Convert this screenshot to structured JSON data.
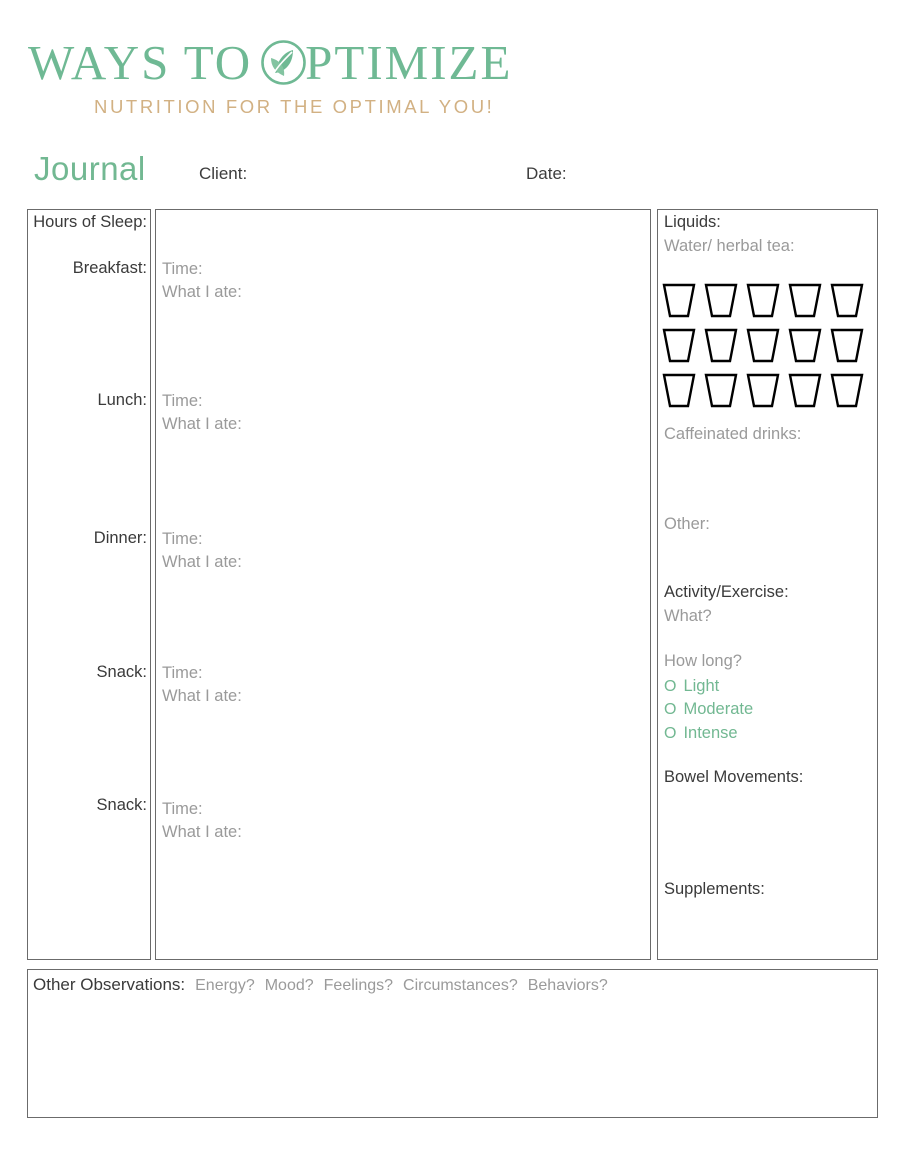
{
  "logo": {
    "word_1": "WAYS TO",
    "word_2": "PTIMIZE",
    "o_mark_icon": "leaf-in-circle-icon",
    "tagline": "NUTRITION FOR THE OPTIMAL YOU!",
    "green": "#6fb994",
    "gold": "#d2b183"
  },
  "title_row": {
    "journal": "Journal",
    "client_label": "Client:",
    "date_label": "Date:"
  },
  "left_column": {
    "sleep_label": "Hours of Sleep:",
    "meals": [
      {
        "label": "Breakfast:"
      },
      {
        "label": "Lunch:"
      },
      {
        "label": "Dinner:"
      },
      {
        "label": "Snack:"
      },
      {
        "label": "Snack:"
      }
    ]
  },
  "middle_column": {
    "entries": [
      {
        "time": "Time:",
        "what": "What I ate:"
      },
      {
        "time": "Time:",
        "what": "What I ate:"
      },
      {
        "time": "Time:",
        "what": "What I ate:"
      },
      {
        "time": "Time:",
        "what": "What I ate:"
      },
      {
        "time": "Time:",
        "what": "What I ate:"
      }
    ]
  },
  "right_column": {
    "liquids_heading": "Liquids:",
    "water_label": "Water/ herbal tea:",
    "cup_icon": "drinking-glass-icon",
    "cup_rows": 3,
    "cups_per_row": 5,
    "cups_total": 15,
    "caffeinated_label": "Caffeinated drinks:",
    "other_label": "Other:",
    "activity_heading": "Activity/Exercise:",
    "activity_what": "What?",
    "activity_how_long": "How long?",
    "intensity_options": [
      {
        "bullet": "O",
        "label": "Light"
      },
      {
        "bullet": "O",
        "label": "Moderate"
      },
      {
        "bullet": "O",
        "label": "Intense"
      }
    ],
    "bowel_heading": "Bowel Movements:",
    "supplements_heading": "Supplements:"
  },
  "observations": {
    "title": "Other Observations:",
    "prompts": [
      "Energy?",
      "Mood?",
      "Feelings?",
      "Circumstances?",
      "Behaviors?"
    ]
  }
}
